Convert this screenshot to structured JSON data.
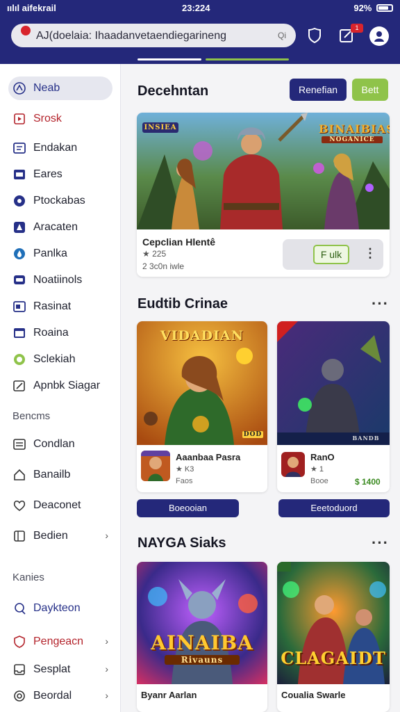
{
  "status": {
    "carrier": "ıılıl aifekrail",
    "time": "23:224",
    "battery": "92%"
  },
  "search": {
    "text": "AJ(doelaia: Ihaadanvetaendiegarineng",
    "clear": "Qi"
  },
  "notifications": {
    "count": "1"
  },
  "sidebar": {
    "items": [
      {
        "label": "Neab",
        "icon": "nav-arrow-icon"
      },
      {
        "label": "Srosk",
        "icon": "bookmark-icon"
      },
      {
        "label": "Endakan",
        "icon": "grid-icon"
      },
      {
        "label": "Eares",
        "icon": "folder-icon"
      },
      {
        "label": "Ptockabas",
        "icon": "circle-icon"
      },
      {
        "label": "Aracaten",
        "icon": "compass-icon"
      },
      {
        "label": "Panlka",
        "icon": "drop-icon"
      },
      {
        "label": "Noatiinols",
        "icon": "chat-icon"
      },
      {
        "label": "Rasinat",
        "icon": "card-icon"
      },
      {
        "label": "Roaina",
        "icon": "window-icon"
      },
      {
        "label": "Sclekiah",
        "icon": "ring-icon"
      },
      {
        "label": "Apnbk Siagar",
        "icon": "pen-icon"
      }
    ],
    "section1": "Bencms",
    "items2": [
      {
        "label": "Condlan",
        "icon": "list-icon"
      },
      {
        "label": "Banailb",
        "icon": "home-icon"
      },
      {
        "label": "Deaconet",
        "icon": "heart-icon"
      },
      {
        "label": "Bedien",
        "icon": "book-icon"
      }
    ],
    "section2": "Kanies",
    "items3": [
      {
        "label": "Daykteon",
        "icon": "person-icon"
      },
      {
        "label": "Pengeacn",
        "icon": "shield-icon"
      },
      {
        "label": "Sesplat",
        "icon": "tray-icon"
      },
      {
        "label": "Beordal",
        "icon": "gear-icon"
      }
    ]
  },
  "featured": {
    "title": "Decehntan",
    "btn_primary": "Renefian",
    "btn_secondary": "Bett",
    "game_title": "BINAIBIAS",
    "game_subtitle": "NOGANICE",
    "badge": "INSIEA",
    "name": "Cepclian Hlentê",
    "rating": "★ 225",
    "meta": "2 3c0n iwle",
    "action": "F ulk"
  },
  "section2": {
    "title": "Eudtib Crinae",
    "cards": [
      {
        "banner": "VIDADIAN",
        "corner": "DOD",
        "name": "Aaanbaa Pasra",
        "rating": "★ K3",
        "meta": "Faos",
        "button": "Boeooian"
      },
      {
        "banner": "",
        "corner": "BANDB",
        "name": "RanO",
        "rating": "★ 1",
        "meta": "Booe",
        "price": "$ 1400",
        "button": "Eeetoduord"
      }
    ]
  },
  "section3": {
    "title": "NAYGA Siaks",
    "cards": [
      {
        "game_title": "AINAIBA",
        "sub": "Rivauns",
        "name": "Byanr Aarlan"
      },
      {
        "game_title": "CLAGAIDT",
        "name": "Coualia Swarle"
      }
    ]
  },
  "colors": {
    "navy": "#24287a",
    "green": "#8fc34a",
    "red": "#d8242c"
  }
}
